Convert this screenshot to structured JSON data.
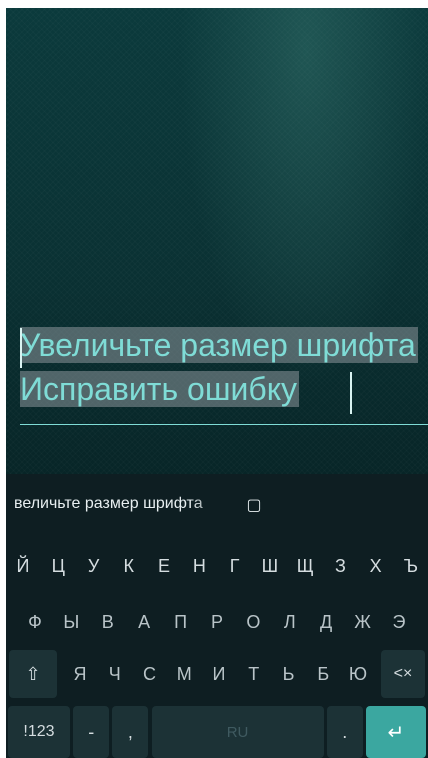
{
  "editor": {
    "line1": "Увеличьте размер шрифта",
    "line2": "Исправить ошибку"
  },
  "suggestion": {
    "text": "величьте размер шрифта",
    "icon": "clipboard-icon",
    "icon_glyph": "▢"
  },
  "keyboard": {
    "row1": [
      "Й",
      "Ц",
      "У",
      "К",
      "Е",
      "Н",
      "Г",
      "Ш",
      "Щ",
      "З",
      "Х",
      "Ъ"
    ],
    "row2": [
      "Ф",
      "Ы",
      "В",
      "А",
      "П",
      "Р",
      "О",
      "Л",
      "Д",
      "Ж",
      "Э"
    ],
    "row3_letters": [
      "Я",
      "Ч",
      "С",
      "М",
      "И",
      "Т",
      "Ь",
      "Б",
      "Ю"
    ],
    "shift_glyph": "⇧",
    "backspace_glyph": "<×",
    "symbols_label": "!123",
    "dash_label": "-",
    "comma_label": ",",
    "space_label": "RU",
    "period_label": ".",
    "enter_glyph": "↵"
  },
  "colors": {
    "text_accent": "#7fdcd6",
    "enter_key": "#3ba7a0",
    "keyboard_bg": "#0e1e22"
  }
}
